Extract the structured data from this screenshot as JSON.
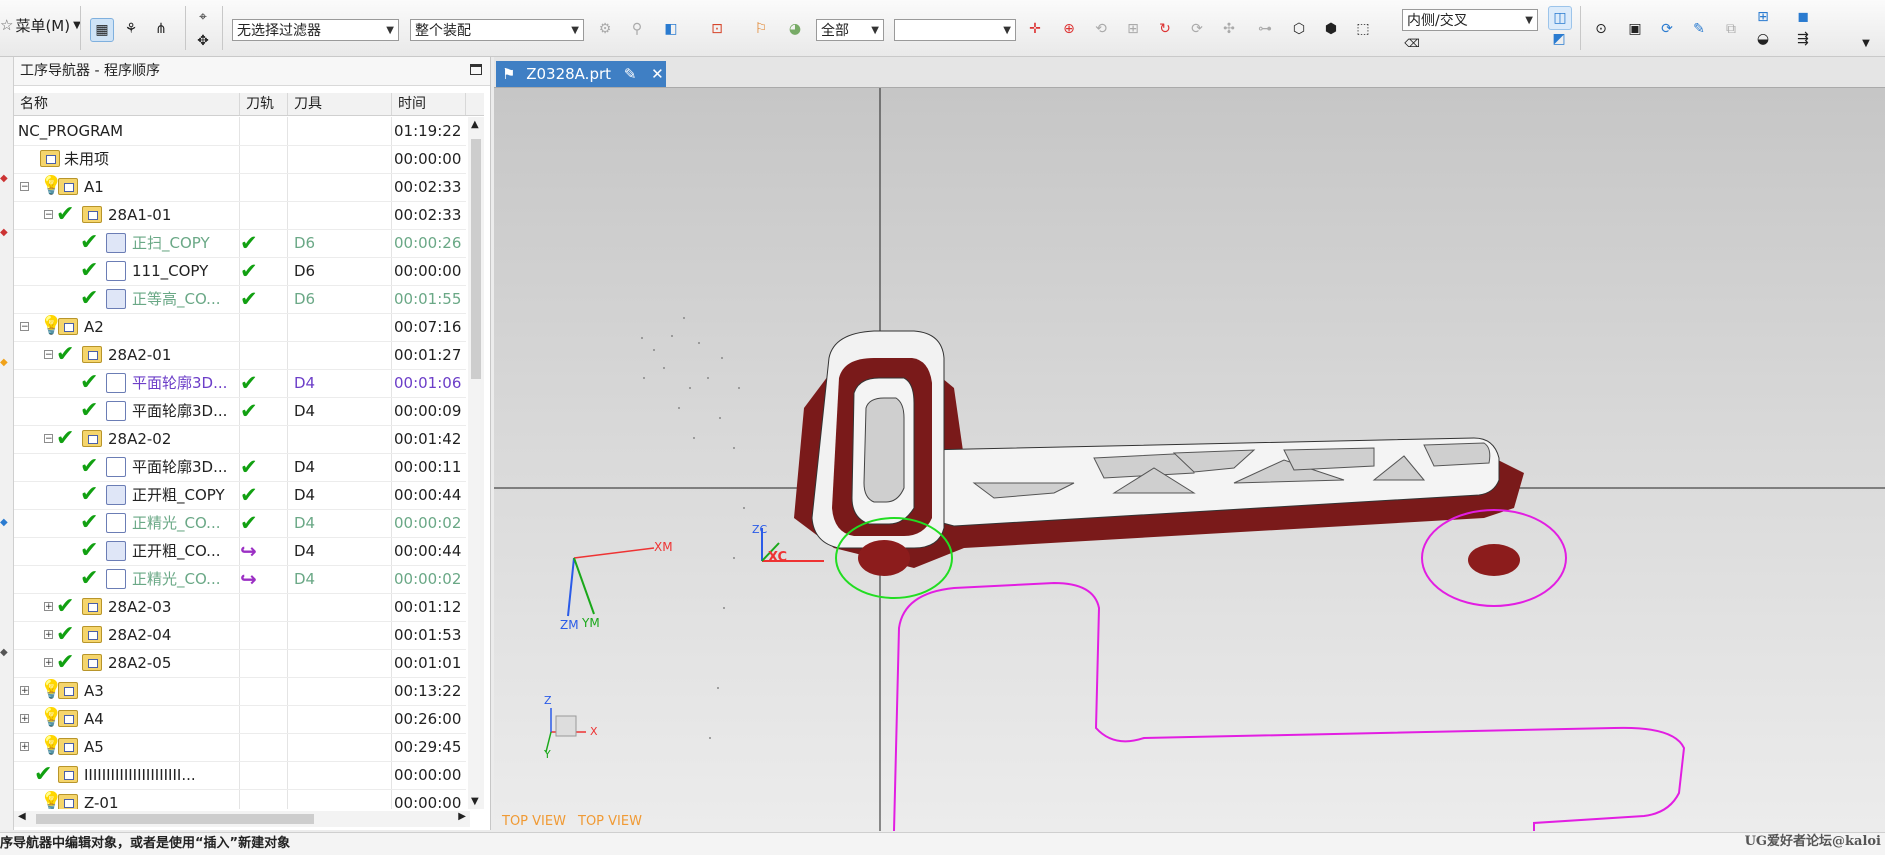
{
  "toolbar": {
    "menu_label": "菜单(M)",
    "filter_select": "无选择过滤器",
    "assembly_select": "整个装配",
    "scope_select": "全部",
    "blank_select": "",
    "snap_select": "内侧/交叉"
  },
  "navigator": {
    "title": "工序导航器 - 程序顺序",
    "columns": {
      "name": "名称",
      "path": "刀轨",
      "tool": "刀具",
      "time": "时间"
    },
    "rows": [
      {
        "name": "NC_PROGRAM",
        "path": "",
        "tool": "",
        "time": "01:19:22"
      },
      {
        "name": "未用项",
        "path": "",
        "tool": "",
        "time": "00:00:00"
      },
      {
        "name": "A1",
        "path": "",
        "tool": "",
        "time": "00:02:33"
      },
      {
        "name": "28A1-01",
        "path": "",
        "tool": "",
        "time": "00:02:33"
      },
      {
        "name": "正扫_COPY",
        "path": "✔",
        "tool": "D6",
        "time": "00:00:26"
      },
      {
        "name": "111_COPY",
        "path": "✔",
        "tool": "D6",
        "time": "00:00:00"
      },
      {
        "name": "正等高_CO...",
        "path": "✔",
        "tool": "D6",
        "time": "00:01:55"
      },
      {
        "name": "A2",
        "path": "",
        "tool": "",
        "time": "00:07:16"
      },
      {
        "name": "28A2-01",
        "path": "",
        "tool": "",
        "time": "00:01:27"
      },
      {
        "name": "平面轮廓3D...",
        "path": "✔",
        "tool": "D4",
        "time": "00:01:06"
      },
      {
        "name": "平面轮廓3D...",
        "path": "✔",
        "tool": "D4",
        "time": "00:00:09"
      },
      {
        "name": "28A2-02",
        "path": "",
        "tool": "",
        "time": "00:01:42"
      },
      {
        "name": "平面轮廓3D...",
        "path": "✔",
        "tool": "D4",
        "time": "00:00:11"
      },
      {
        "name": "正开粗_COPY",
        "path": "✔",
        "tool": "D4",
        "time": "00:00:44"
      },
      {
        "name": "正精光_CO...",
        "path": "✔",
        "tool": "D4",
        "time": "00:00:02"
      },
      {
        "name": "正开粗_CO...",
        "path": "↪",
        "tool": "D4",
        "time": "00:00:44"
      },
      {
        "name": "正精光_CO...",
        "path": "↪",
        "tool": "D4",
        "time": "00:00:02"
      },
      {
        "name": "28A2-03",
        "path": "",
        "tool": "",
        "time": "00:01:12"
      },
      {
        "name": "28A2-04",
        "path": "",
        "tool": "",
        "time": "00:01:53"
      },
      {
        "name": "28A2-05",
        "path": "",
        "tool": "",
        "time": "00:01:01"
      },
      {
        "name": "A3",
        "path": "",
        "tool": "",
        "time": "00:13:22"
      },
      {
        "name": "A4",
        "path": "",
        "tool": "",
        "time": "00:26:00"
      },
      {
        "name": "A5",
        "path": "",
        "tool": "",
        "time": "00:29:45"
      },
      {
        "name": "IIIIIIIIIIIIIIIIIIIIII...",
        "path": "",
        "tool": "",
        "time": "00:00:00"
      },
      {
        "name": "Z-01",
        "path": "",
        "tool": "",
        "time": "00:00:00"
      }
    ]
  },
  "graphics": {
    "tab_title": "Z0328A.prt",
    "view_label_1": "TOP VIEW",
    "view_label_2": "TOP VIEW",
    "axis_xc": "XC",
    "axis_zc": "ZC",
    "axis_xm": "XM",
    "axis_ym": "YM",
    "axis_zm": "ZM",
    "triad_x": "X",
    "triad_y": "Y",
    "triad_z": "Z"
  },
  "status": {
    "message": "序导航器中编辑对象，或者是使用“插入”新建对象"
  },
  "watermark": "UG爱好者论坛@kaloi",
  "colors": {
    "accent": "#3f7fc4",
    "part_body": "#7a1a1a",
    "toolpath": "#e21ee2",
    "check": "#11a011"
  }
}
